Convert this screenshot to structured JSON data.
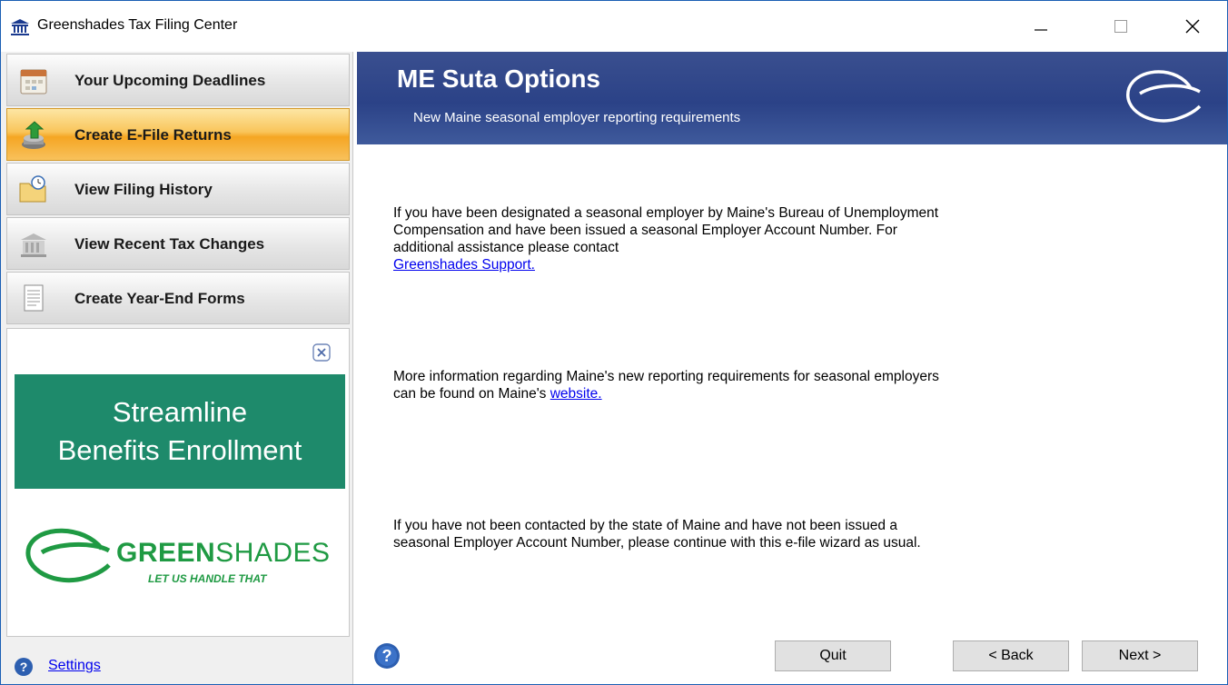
{
  "window": {
    "title": "Greenshades Tax Filing Center",
    "icon": "bank-icon"
  },
  "controls": {
    "minimize": "minimize-icon",
    "maximize": "maximize-icon",
    "close": "close-icon"
  },
  "sidebar": {
    "items": [
      {
        "label": "Your Upcoming Deadlines",
        "icon": "calendar-icon",
        "active": false
      },
      {
        "label": "Create E-File Returns",
        "icon": "efile-upload-icon",
        "active": true
      },
      {
        "label": "View Filing History",
        "icon": "folder-clock-icon",
        "active": false
      },
      {
        "label": "View Recent Tax Changes",
        "icon": "building-icon",
        "active": false
      },
      {
        "label": "Create Year-End Forms",
        "icon": "document-icon",
        "active": false
      }
    ],
    "ad": {
      "line1": "Streamline",
      "line2": "Benefits Enrollment",
      "brand_bold": "GREEN",
      "brand_light": "SHADES",
      "tagline": "LET US HANDLE THAT"
    },
    "settings_label": "Settings"
  },
  "header": {
    "title": "ME Suta Options",
    "subtitle": "New Maine seasonal employer reporting requirements"
  },
  "content": {
    "p1_text": "If you have been designated a seasonal employer by Maine's Bureau of Unemployment Compensation and have been issued a seasonal Employer Account Number. For additional assistance please contact",
    "p1_link": "Greenshades Support.",
    "p2_text": "More information regarding Maine's new reporting requirements for seasonal employers can be found on Maine's",
    "p2_link": "website.",
    "p3_text": "If you have not been contacted by the state of Maine and have not been issued a seasonal Employer Account Number, please continue with this e-file wizard as usual."
  },
  "buttons": {
    "quit": "Quit",
    "back": "< Back",
    "next": "Next >"
  },
  "colors": {
    "header_blue": "#2b4287",
    "active_orange": "#f5a623",
    "ad_green": "#1e8a6b",
    "brand_green": "#1f9a43",
    "link_blue": "#0000ee"
  }
}
